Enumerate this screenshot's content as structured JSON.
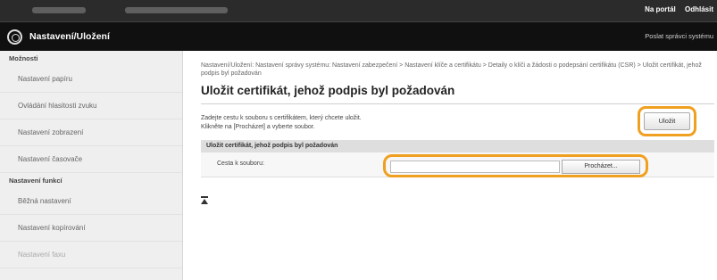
{
  "topbar": {
    "links": [
      "Na portál",
      "Odhlásit"
    ]
  },
  "titlebar": {
    "title": "Nastavení/Uložení",
    "send_admin": "Poslat správci systému"
  },
  "sidebar": {
    "groups": [
      {
        "label": "Možnosti",
        "items": [
          "Nastavení papíru",
          "Ovládání hlasitosti zvuku",
          "Nastavení zobrazení",
          "Nastavení časovače"
        ]
      },
      {
        "label": "Nastavení funkcí",
        "items": [
          "Běžná nastavení",
          "Nastavení kopírování",
          "Nastavení faxu"
        ]
      }
    ]
  },
  "main": {
    "breadcrumb": "Nastavení/Uložení: Nastavení správy systému: Nastavení zabezpečení > Nastavení klíče a certifikátu > Detaily o klíči a žádosti o podepsání certifikátu (CSR) > Uložit certifikát, jehož podpis byl požadován",
    "heading": "Uložit certifikát, jehož podpis byl požadován",
    "desc_line1": "Zadejte cestu k souboru s certifikátem, který chcete uložit.",
    "desc_line2": "Klikněte na [Procházet] a vyberte soubor.",
    "save_label": "Uložit",
    "section_title": "Uložit certifikát, jehož podpis byl požadován",
    "path_label": "Cesta k souboru:",
    "path_value": "",
    "browse_label": "Procházet..."
  },
  "colors": {
    "highlight": "#f0a020",
    "header_bg": "#101010"
  }
}
